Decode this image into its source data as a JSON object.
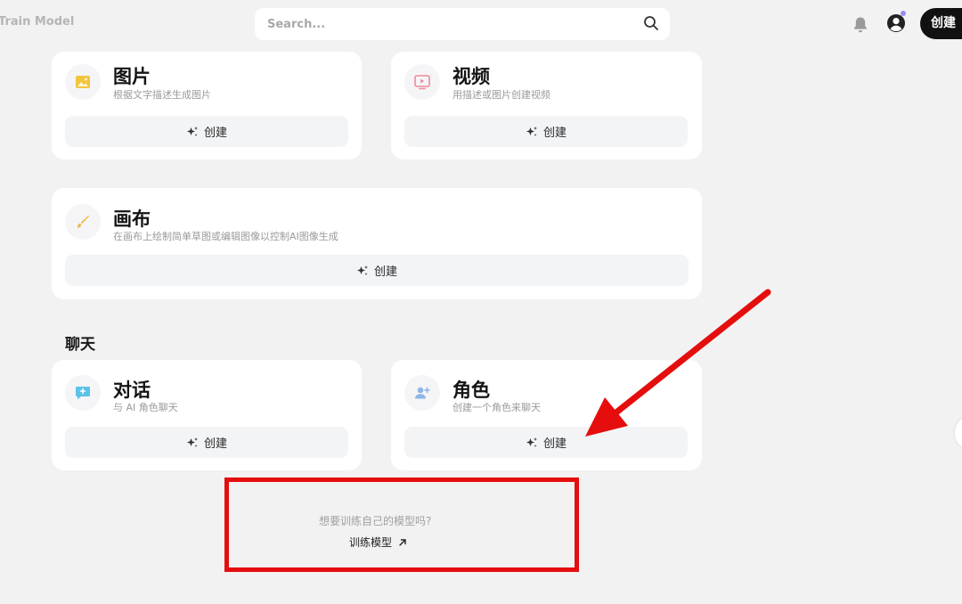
{
  "header": {
    "brand": "Train Model",
    "search_placeholder": "Search...",
    "create_label": "创建"
  },
  "cards": [
    {
      "id": "image",
      "title": "图片",
      "subtitle": "根据文字描述生成图片",
      "button": "创建",
      "icon": "image-icon"
    },
    {
      "id": "video",
      "title": "视频",
      "subtitle": "用描述或图片创建视频",
      "button": "创建",
      "icon": "video-icon"
    },
    {
      "id": "canvas",
      "title": "画布",
      "subtitle": "在画布上绘制简单草图或编辑图像以控制AI图像生成",
      "button": "创建",
      "icon": "brush-icon"
    },
    {
      "id": "dialog",
      "title": "对话",
      "subtitle": "与 AI 角色聊天",
      "button": "创建",
      "icon": "chat-icon"
    },
    {
      "id": "role",
      "title": "角色",
      "subtitle": "创建一个角色来聊天",
      "button": "创建",
      "icon": "add-person-icon"
    }
  ],
  "section_chat": "聊天",
  "train": {
    "question": "想要训练自己的模型吗?",
    "link": "训练模型"
  },
  "colors": {
    "accent_dark": "#111111",
    "annotation_red": "#e50d0d",
    "image_icon": "#f2c53d",
    "video_icon": "#ef8a9a",
    "brush_icon": "#f0b64a",
    "chat_icon": "#5cc2e8",
    "person_icon": "#8fb6e6"
  }
}
